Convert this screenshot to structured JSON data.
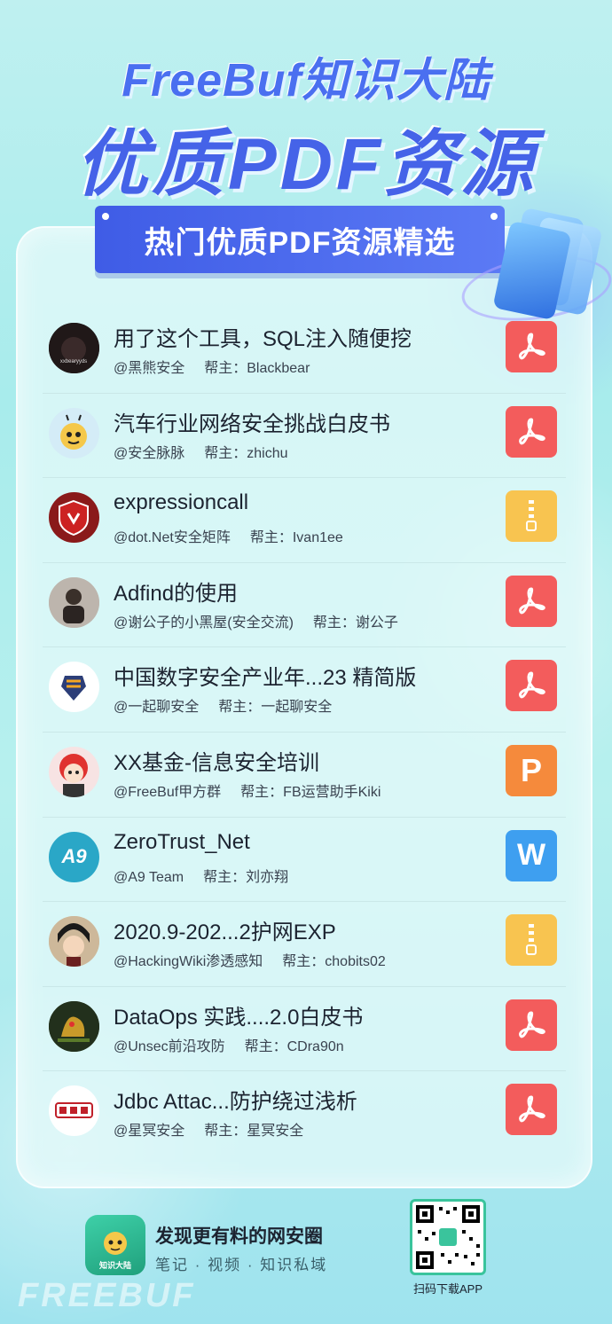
{
  "header": {
    "title_line1": "FreeBuf知识大陆",
    "title_line2": "优质PDF资源",
    "ribbon": "热门优质PDF资源精选"
  },
  "items": [
    {
      "title": "用了这个工具，SQL注入随便挖",
      "channel": "@黑熊安全",
      "owner": "帮主：Blackbear",
      "file_type": "pdf",
      "avatar_icon": "black-cat-avatar-icon"
    },
    {
      "title": "汽车行业网络安全挑战白皮书",
      "channel": "@安全脉脉",
      "owner": "帮主：zhichu",
      "file_type": "pdf",
      "avatar_icon": "bee-avatar-icon"
    },
    {
      "title": "expressioncall",
      "channel": "@dot.Net安全矩阵",
      "owner": "帮主：Ivan1ee",
      "file_type": "zip",
      "avatar_icon": "shield-avatar-icon"
    },
    {
      "title": "Adfind的使用",
      "channel": "@谢公子的小黑屋(安全交流)",
      "owner": "帮主：谢公子",
      "file_type": "pdf",
      "avatar_icon": "photo-avatar-icon"
    },
    {
      "title": "中国数字安全产业年...23 精简版",
      "channel": "@一起聊安全",
      "owner": "帮主：一起聊安全",
      "file_type": "pdf",
      "avatar_icon": "badge-avatar-icon"
    },
    {
      "title": "XX基金-信息安全培训",
      "channel": "@FreeBuf甲方群",
      "owner": "帮主：FB运营助手Kiki",
      "file_type": "ppt",
      "ppt_letter": "P",
      "avatar_icon": "redhead-avatar-icon"
    },
    {
      "title": "ZeroTrust_Net",
      "channel": "@A9 Team",
      "owner": "帮主：刘亦翔",
      "file_type": "doc",
      "doc_letter": "W",
      "avatar_text": "A9",
      "avatar_icon": "a9-logo-avatar-icon"
    },
    {
      "title": "2020.9-202...2护网EXP",
      "channel": "@HackingWiki渗透感知",
      "owner": "帮主：chobits02",
      "file_type": "zip",
      "avatar_icon": "anime-avatar-icon"
    },
    {
      "title": "DataOps 实践....2.0白皮书",
      "channel": "@Unsec前沿攻防",
      "owner": "帮主：CDra90n",
      "file_type": "pdf",
      "avatar_icon": "dragon-avatar-icon"
    },
    {
      "title": "Jdbc Attac...防护绕过浅析",
      "channel": "@星冥安全",
      "owner": "帮主：星冥安全",
      "file_type": "pdf",
      "avatar_icon": "stamp-avatar-icon"
    }
  ],
  "footer": {
    "app_badge": "知识大陆",
    "headline": "发现更有料的网安圈",
    "sub": "笔记 · 视频 · 知识私域",
    "qr_label": "扫码下载APP",
    "watermark": "FREEBUF"
  },
  "colors": {
    "accent": "#4563e8",
    "pdf": "#f35c5c",
    "zip": "#f8c450",
    "ppt": "#f58a3c",
    "doc": "#3e9ff0"
  }
}
